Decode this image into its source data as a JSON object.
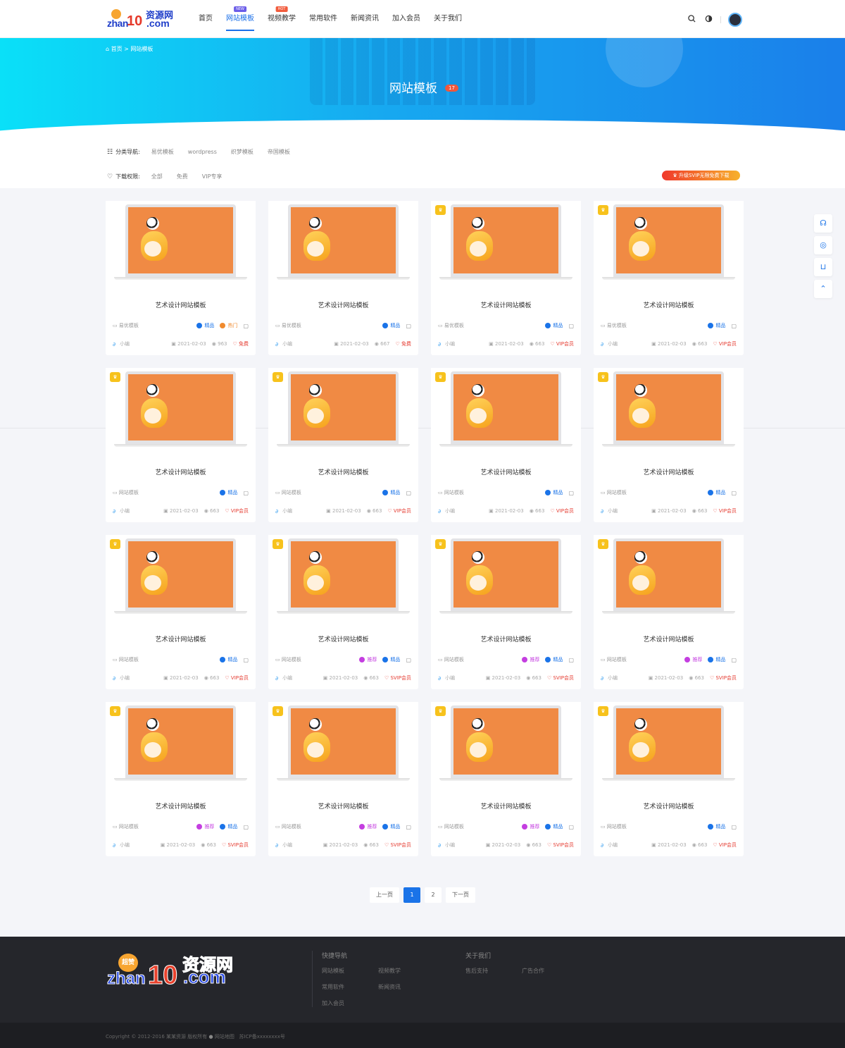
{
  "header": {
    "logo": {
      "cn": "资源网",
      "zh": "zhan",
      "ten": "10",
      "com": ".com"
    },
    "nav": [
      {
        "label": "首页",
        "tag": "",
        "active": false
      },
      {
        "label": "网站模板",
        "tag": "NEW",
        "active": true
      },
      {
        "label": "视频教学",
        "tag": "HOT",
        "active": false
      },
      {
        "label": "常用软件",
        "tag": "",
        "active": false
      },
      {
        "label": "新闻资讯",
        "tag": "",
        "active": false
      },
      {
        "label": "加入会员",
        "tag": "",
        "active": false
      },
      {
        "label": "关于我们",
        "tag": "",
        "active": false
      }
    ]
  },
  "banner": {
    "breadcrumb_home": "首页",
    "breadcrumb_sep": ">",
    "breadcrumb_current": "网站模板",
    "title": "网站模板",
    "count": "17"
  },
  "filters": {
    "category_label": "分类导航:",
    "categories": [
      "易优模板",
      "wordpress",
      "织梦模板",
      "帝国模板"
    ],
    "permission_label": "下载权限:",
    "permissions": [
      "全部",
      "免费",
      "VIP专享"
    ],
    "upgrade_button": "升级SVIP无限免费下载"
  },
  "cards": [
    {
      "title": "艺术设计网站模板",
      "category": "易优模板",
      "tags": [
        "精品",
        "热门"
      ],
      "author": "小编",
      "date": "2021-02-03",
      "views": "963",
      "price": "免费",
      "vip_flag": false
    },
    {
      "title": "艺术设计网站模板",
      "category": "易优模板",
      "tags": [
        "精品"
      ],
      "author": "小编",
      "date": "2021-02-03",
      "views": "667",
      "price": "免费",
      "vip_flag": false
    },
    {
      "title": "艺术设计网站模板",
      "category": "易优模板",
      "tags": [
        "精品"
      ],
      "author": "小编",
      "date": "2021-02-03",
      "views": "663",
      "price": "VIP会员",
      "vip_flag": true
    },
    {
      "title": "艺术设计网站模板",
      "category": "易优模板",
      "tags": [
        "精品"
      ],
      "author": "小编",
      "date": "2021-02-03",
      "views": "663",
      "price": "VIP会员",
      "vip_flag": true
    },
    {
      "title": "艺术设计网站模板",
      "category": "网站模板",
      "tags": [
        "精品"
      ],
      "author": "小编",
      "date": "2021-02-03",
      "views": "663",
      "price": "VIP会员",
      "vip_flag": true
    },
    {
      "title": "艺术设计网站模板",
      "category": "网站模板",
      "tags": [
        "精品"
      ],
      "author": "小编",
      "date": "2021-02-03",
      "views": "663",
      "price": "VIP会员",
      "vip_flag": true
    },
    {
      "title": "艺术设计网站模板",
      "category": "网站模板",
      "tags": [
        "精品"
      ],
      "author": "小编",
      "date": "2021-02-03",
      "views": "663",
      "price": "VIP会员",
      "vip_flag": true
    },
    {
      "title": "艺术设计网站模板",
      "category": "网站模板",
      "tags": [
        "精品"
      ],
      "author": "小编",
      "date": "2021-02-03",
      "views": "663",
      "price": "VIP会员",
      "vip_flag": true
    },
    {
      "title": "艺术设计网站模板",
      "category": "网站模板",
      "tags": [
        "精品"
      ],
      "author": "小编",
      "date": "2021-02-03",
      "views": "663",
      "price": "VIP会员",
      "vip_flag": true
    },
    {
      "title": "艺术设计网站模板",
      "category": "网站模板",
      "tags": [
        "推荐",
        "精品"
      ],
      "author": "小编",
      "date": "2021-02-03",
      "views": "663",
      "price": "SVIP会员",
      "vip_flag": true
    },
    {
      "title": "艺术设计网站模板",
      "category": "网站模板",
      "tags": [
        "推荐",
        "精品"
      ],
      "author": "小编",
      "date": "2021-02-03",
      "views": "663",
      "price": "SVIP会员",
      "vip_flag": true
    },
    {
      "title": "艺术设计网站模板",
      "category": "网站模板",
      "tags": [
        "推荐",
        "精品"
      ],
      "author": "小编",
      "date": "2021-02-03",
      "views": "663",
      "price": "SVIP会员",
      "vip_flag": true
    },
    {
      "title": "艺术设计网站模板",
      "category": "网站模板",
      "tags": [
        "推荐",
        "精品"
      ],
      "author": "小编",
      "date": "2021-02-03",
      "views": "663",
      "price": "SVIP会员",
      "vip_flag": true
    },
    {
      "title": "艺术设计网站模板",
      "category": "网站模板",
      "tags": [
        "推荐",
        "精品"
      ],
      "author": "小编",
      "date": "2021-02-03",
      "views": "663",
      "price": "SVIP会员",
      "vip_flag": true
    },
    {
      "title": "艺术设计网站模板",
      "category": "网站模板",
      "tags": [
        "推荐",
        "精品"
      ],
      "author": "小编",
      "date": "2021-02-03",
      "views": "663",
      "price": "SVIP会员",
      "vip_flag": true
    },
    {
      "title": "艺术设计网站模板",
      "category": "网站模板",
      "tags": [
        "精品"
      ],
      "author": "小编",
      "date": "2021-02-03",
      "views": "663",
      "price": "VIP会员",
      "vip_flag": true
    }
  ],
  "pagination": {
    "prev": "上一页",
    "pages": [
      "1",
      "2"
    ],
    "current": "1",
    "next": "下一页"
  },
  "sidebar_icons": [
    "headset-icon",
    "wechat-icon",
    "cart-icon",
    "back-to-top-icon"
  ],
  "footer": {
    "logo": {
      "badge": "超赞",
      "cn": "资源网",
      "zh": "zhan",
      "ten": "10",
      "com": ".com"
    },
    "quick_nav_title": "快捷导航",
    "quick_nav": [
      "网站模板",
      "视频教学",
      "常用软件",
      "新闻资讯",
      "加入会员"
    ],
    "about_title": "关于我们",
    "about_links": [
      "售后支持",
      "广告合作"
    ],
    "copyright": "Copyright © 2012-2016 某某资源 版权所有",
    "sitemap": "网站地图",
    "icp": "苏ICP备xxxxxxxx号"
  },
  "colors": {
    "accent": "#1a73e8",
    "price": "#e53a2f",
    "vip_flag": "#f7c21c",
    "footer_bg": "#25262b"
  }
}
